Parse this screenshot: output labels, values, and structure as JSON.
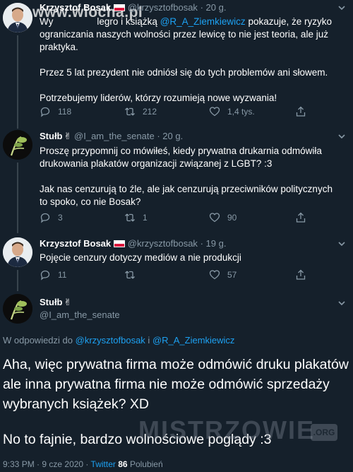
{
  "watermark_top": "www.wiocha.pl",
  "watermark_bottom": "MISTRZOWIE",
  "watermark_org": ".ORG",
  "tweet1": {
    "name": "Krzysztof Bosak",
    "handle": "@krzysztofbosak",
    "time": "20 g.",
    "line1_start": "Wy",
    "line1_mid": "legro i książką",
    "mention": "@R_A_Ziemkiewicz",
    "line1_end": "pokazuje, że ryzyko",
    "line2": "ograniczania naszych wolności przez lewicę to nie jest teoria, ale już praktyka.",
    "p2": "Przez 5 lat prezydent nie odniósł się do tych problemów ani słowem.",
    "p3": "Potrzebujemy liderów, którzy rozumieją nowe wyzwania!",
    "replies": "118",
    "retweets": "212",
    "likes": "1,4 tys."
  },
  "tweet2": {
    "name": "Stułb",
    "emoji": "✌",
    "handle": "@I_am_the_senate",
    "time": "20 g.",
    "p1": "Proszę przypomnij co mówiłeś, kiedy prywatna drukarnia odmówiła drukowania plakatów organizacji związanej z LGBT? :3",
    "p2": "Jak nas cenzurują to źle, ale jak cenzurują przeciwników politycznych to spoko, co nie Bosak?",
    "replies": "3",
    "retweets": "1",
    "likes": "90"
  },
  "tweet3": {
    "name": "Krzysztof Bosak",
    "handle": "@krzysztofbosak",
    "time": "19 g.",
    "p1": "Pojęcie cenzury dotyczy mediów a nie produkcji",
    "replies": "11",
    "retweets": "",
    "likes": "57"
  },
  "tweet4": {
    "name": "Stułb",
    "emoji": "✌",
    "handle": "@I_am_the_senate",
    "reply_prefix": "W odpowiedzi do",
    "reply_user1": "@krzysztofbosak",
    "reply_and": "i",
    "reply_user2": "@R_A_Ziemkiewicz",
    "p1": "Aha, więc prywatna firma może odmówić druku plakatów ale inna prywatna firma nie może odmówić sprzedaży wybranych książek? XD",
    "p2": "No to fajnie, bardzo wolnościowe poglądy :3",
    "time": "9:33 PM",
    "date": "9 cze 2020",
    "source": "Twitter",
    "likes_count": "86",
    "likes_label": "Polubień"
  },
  "icons": {
    "reply": "reply-icon",
    "retweet": "retweet-icon",
    "like": "heart-icon",
    "share": "share-icon",
    "more": "chevron-down-icon"
  },
  "colors": {
    "background": "#15202b",
    "secondary_text": "#8899a6",
    "link": "#1da1f2",
    "divider": "#38444d"
  }
}
